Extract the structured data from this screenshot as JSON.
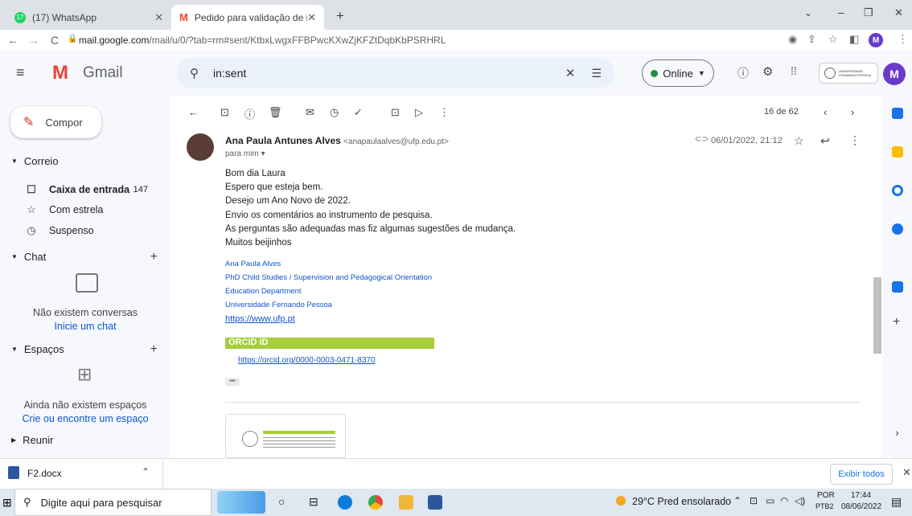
{
  "browser": {
    "tabs": [
      {
        "label": "(17) WhatsApp",
        "badge": "17"
      },
      {
        "label": "Pedido para validação de instrum"
      }
    ],
    "url_host": "mail.google.com",
    "url_path": "/mail/u/0/?tab=rm#sent/KtbxLwgxFFBPwcKXwZjKFZtDqbKbPSRHRL",
    "profile_initial": "M"
  },
  "gmail": {
    "logo": "Gmail",
    "search_value": "in:sent",
    "status": "Online",
    "org_name": "UNIVERSIDADE FERNANDO PESSOA",
    "avatar_initial": "M"
  },
  "sidebar": {
    "compose": "Compor",
    "mail_section": "Correio",
    "items": [
      {
        "label": "Caixa de entrada",
        "count": "147"
      },
      {
        "label": "Com estrela"
      },
      {
        "label": "Suspenso"
      }
    ],
    "chat_section": "Chat",
    "chat_empty": "Não existem conversas",
    "chat_link": "Inicie um chat",
    "spaces_section": "Espaços",
    "spaces_empty": "Ainda não existem espaços",
    "spaces_link": "Crie ou encontre um espaço",
    "meet_section": "Reunir"
  },
  "toolbar": {
    "pagination": "16 de 62"
  },
  "message": {
    "sender_name": "Ana Paula Antunes Alves",
    "sender_email": "<anapaulaalves@ufp.edu.pt>",
    "to": "para mim",
    "date": "06/01/2022, 21:12",
    "body": [
      "Bom dia Laura",
      "Espero que esteja bem.",
      "Desejo um Ano Novo de 2022.",
      "Envio os comentários ao instrumento de pesquisa.",
      "As perguntas são adequadas mas fiz algumas sugestões de mudança.",
      "Muitos beijinhos"
    ],
    "signature": [
      "Ana Paula Alves",
      "PhD Child Studies / Supervision and Pedagogical Orientation",
      "Education Department",
      "Universidade Fernando Pessoa"
    ],
    "sig_url": "https://www.ufp.pt",
    "orcid_label": "ORCID iD",
    "orcid_url": "https://orcid.org/0000-0003-0471-8370",
    "ellipsis": "•••"
  },
  "downloads": {
    "file": "F2.docx",
    "show_all": "Exibir todos"
  },
  "taskbar": {
    "search_placeholder": "Digite aqui para pesquisar",
    "weather": "29°C  Pred ensolarado",
    "lang": "POR",
    "lang2": "PTB2",
    "time": "17:44",
    "date": "08/06/2022"
  },
  "colors": {
    "accent": "#0b57d0",
    "gmail_red": "#ea4335",
    "orcid_green": "#a6ce39"
  }
}
